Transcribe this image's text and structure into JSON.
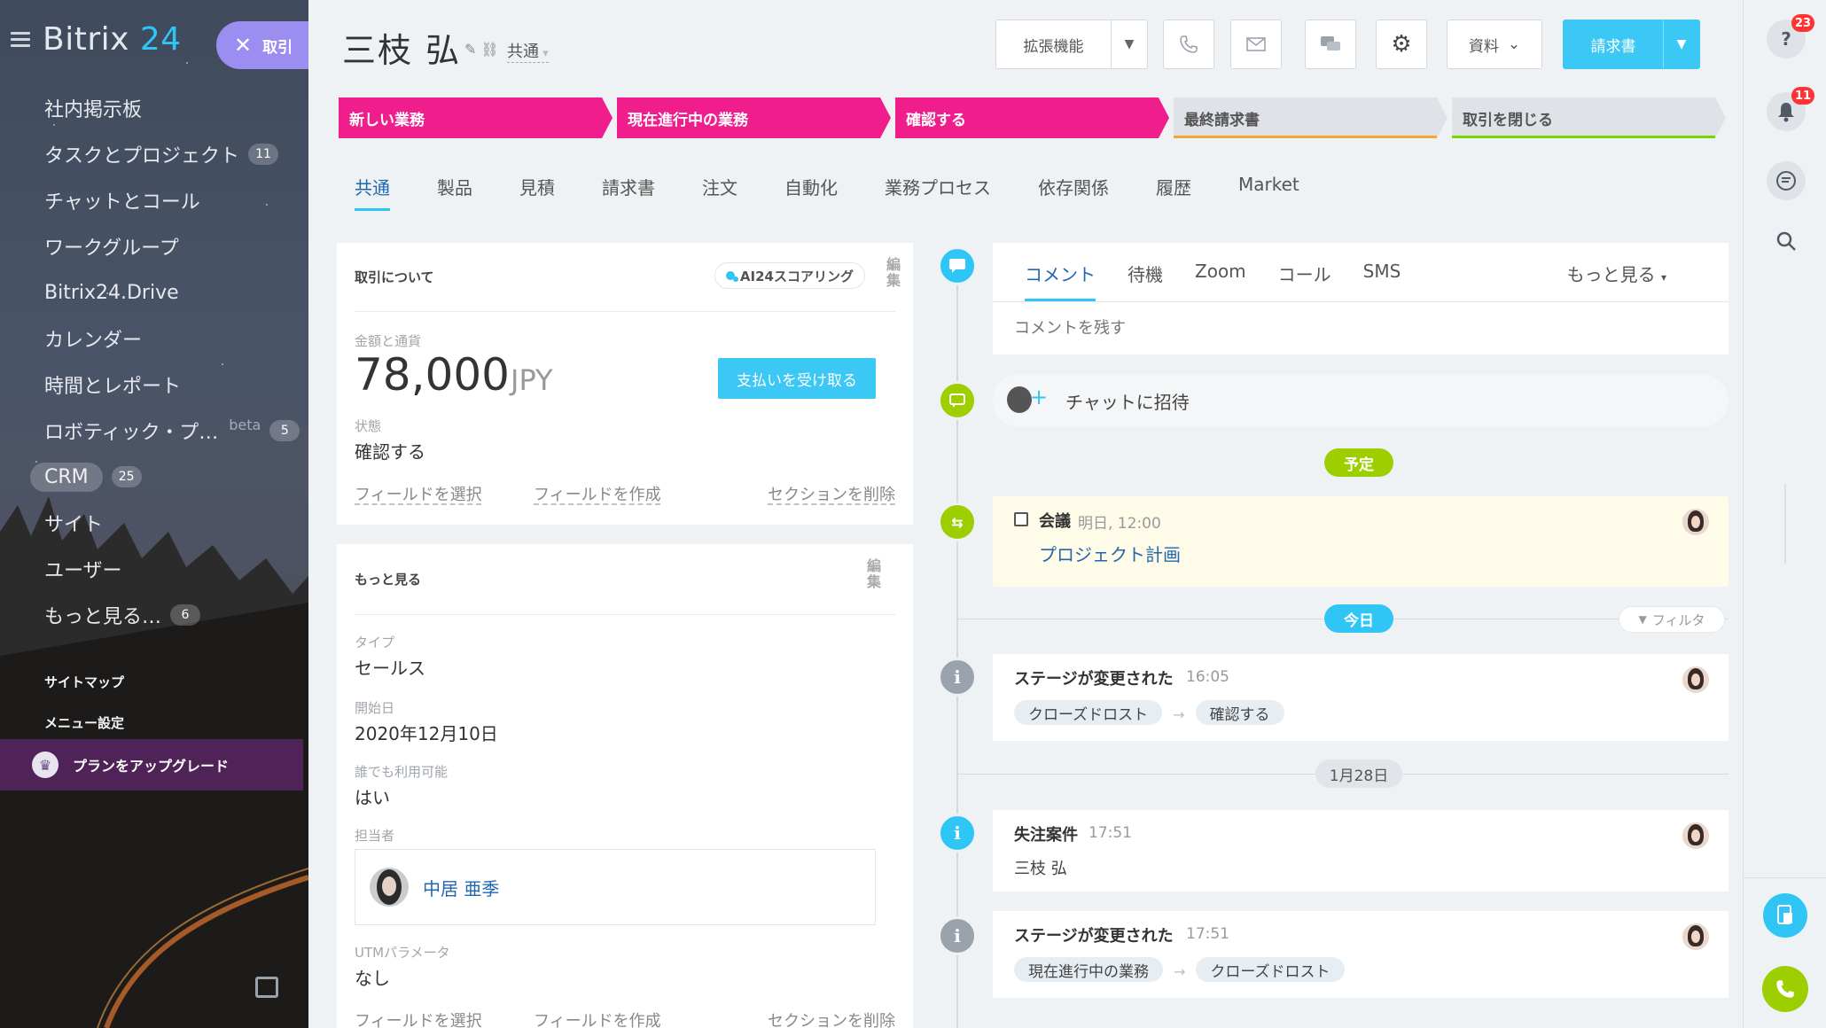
{
  "sidebar": {
    "logo_main": "Bitrix",
    "logo_num": "24",
    "deal_button": "取引",
    "items": [
      {
        "label": "社内掲示板",
        "count": ""
      },
      {
        "label": "タスクとプロジェクト",
        "count": "11"
      },
      {
        "label": "チャットとコール",
        "count": ""
      },
      {
        "label": "ワークグループ",
        "count": ""
      },
      {
        "label": "Bitrix24.Drive",
        "count": ""
      },
      {
        "label": "カレンダー",
        "count": ""
      },
      {
        "label": "時間とレポート",
        "count": ""
      },
      {
        "label": "ロボティック・プ…",
        "count": "5",
        "beta": "beta"
      },
      {
        "label": "CRM",
        "count": "25"
      },
      {
        "label": "サイト",
        "count": ""
      },
      {
        "label": "ユーザー",
        "count": ""
      },
      {
        "label": "もっと見る…",
        "count": "6"
      }
    ],
    "sitemap": "サイトマップ",
    "menu_settings": "メニュー設定",
    "upgrade": "プランをアップグレード"
  },
  "header": {
    "title": "三枝 弘",
    "category": "共通",
    "toolbar": {
      "extensions": "拡張機能",
      "docs": "資料",
      "invoice": "請求書"
    }
  },
  "stages": [
    {
      "label": "新しい業務",
      "state": "on"
    },
    {
      "label": "現在進行中の業務",
      "state": "on"
    },
    {
      "label": "確認する",
      "state": "on"
    },
    {
      "label": "最終請求書",
      "state": "off",
      "underline": "#f7a62b"
    },
    {
      "label": "取引を閉じる",
      "state": "off",
      "underline": "#7bd500"
    }
  ],
  "tabs": [
    "共通",
    "製品",
    "見積",
    "請求書",
    "注文",
    "自動化",
    "業務プロセス",
    "依存関係",
    "履歴",
    "Market"
  ],
  "about_card": {
    "title": "取引について",
    "ai_scoring": "AI24スコアリング",
    "edit": "編集",
    "amount_label": "金額と通貨",
    "amount": "78,000",
    "currency": "JPY",
    "pay_button": "支払いを受け取る",
    "status_label": "状態",
    "status": "確認する",
    "select_field": "フィールドを選択",
    "create_field": "フィールドを作成",
    "delete_section": "セクションを削除"
  },
  "more_card": {
    "title": "もっと見る",
    "edit": "編集",
    "type_label": "タイプ",
    "type": "セールス",
    "start_label": "開始日",
    "start": "2020年12月10日",
    "available_label": "誰でも利用可能",
    "available": "はい",
    "owner_label": "担当者",
    "owner": "中居 亜季",
    "utm_label": "UTMパラメータ",
    "utm": "なし",
    "select_field": "フィールドを選択",
    "create_field": "フィールドを作成",
    "delete_section": "セクションを削除"
  },
  "timeline": {
    "tabs": [
      "コメント",
      "待機",
      "Zoom",
      "コール",
      "SMS"
    ],
    "more": "もっと見る",
    "comment_placeholder": "コメントを残す",
    "invite_chat": "チャットに招待",
    "planned_label": "予定",
    "meeting_title": "会議",
    "meeting_time": "明日, 12:00",
    "meeting_link": "プロジェクト計画",
    "today_label": "今日",
    "filter": "フィルタ",
    "entry1_title": "ステージが変更された",
    "entry1_time": "16:05",
    "entry1_from": "クローズドロスト",
    "entry1_to": "確認する",
    "date_label": "1月28日",
    "entry2_title": "失注案件",
    "entry2_time": "17:51",
    "entry2_text": "三枝 弘",
    "entry3_title": "ステージが変更された",
    "entry3_time": "17:51",
    "entry3_from": "現在進行中の業務",
    "entry3_to": "クローズドロスト"
  },
  "rightbar": {
    "help_badge": "23",
    "notif_badge": "11"
  },
  "colors": {
    "accent": "#2fc6f6",
    "stage_on": "#ef1e8c",
    "green": "#9dcf00",
    "sidebar_active": "#9b8ef0"
  }
}
